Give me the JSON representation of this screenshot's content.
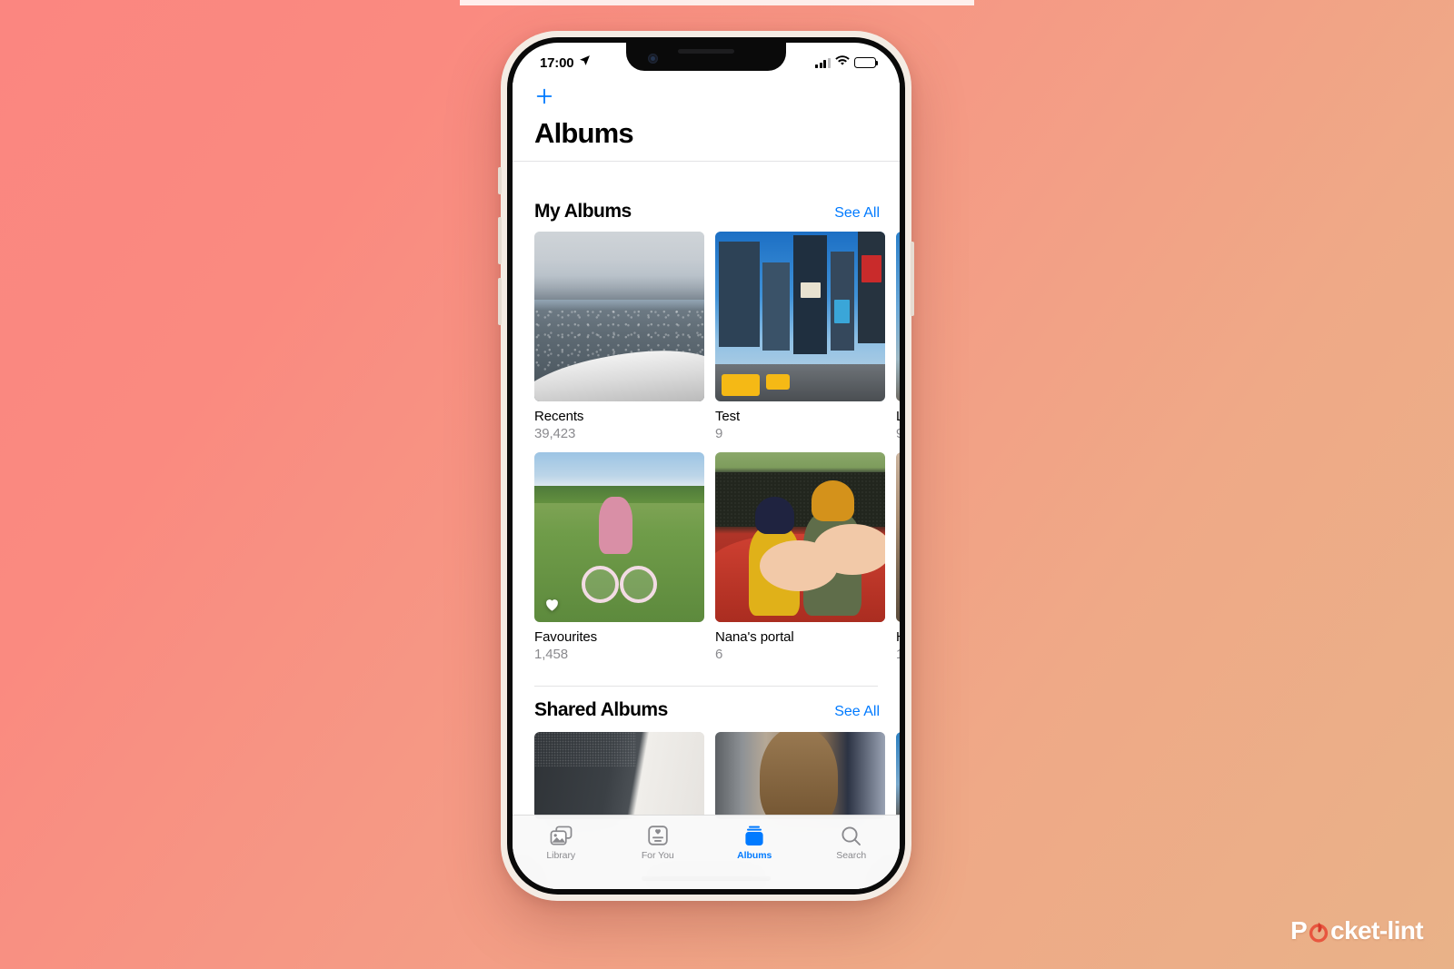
{
  "background": {
    "gradient_from": "#fb8680",
    "gradient_to": "#e9b288"
  },
  "status_bar": {
    "time": "17:00",
    "location_icon": "location-arrow-icon",
    "signal_icon": "cellular-signal-icon",
    "wifi_icon": "wifi-icon",
    "battery_icon": "battery-icon"
  },
  "nav": {
    "add_icon": "plus-icon",
    "title": "Albums"
  },
  "sections": [
    {
      "title": "My Albums",
      "see_all": "See All",
      "albums": [
        {
          "name": "Recents",
          "count": "39,423",
          "thumb": "aerial-view-from-plane",
          "badge": null
        },
        {
          "name": "Test",
          "count": "9",
          "thumb": "times-square-city",
          "badge": null
        },
        {
          "name": "L",
          "count": "9",
          "thumb": "city-street-partial",
          "badge": null
        },
        {
          "name": "Favourites",
          "count": "1,458",
          "thumb": "child-on-bicycle",
          "badge": "heart-icon"
        },
        {
          "name": "Nana's portal",
          "count": "6",
          "thumb": "kids-in-red-wagon",
          "badge": null
        },
        {
          "name": "H",
          "count": "1",
          "thumb": "partial-photo",
          "badge": null
        }
      ]
    },
    {
      "title": "Shared Albums",
      "see_all": "See All",
      "albums": [
        {
          "name": "",
          "count": "",
          "thumb": "dark-grey-room",
          "badge": null
        },
        {
          "name": "",
          "count": "",
          "thumb": "baby-on-airplane",
          "badge": null
        },
        {
          "name": "",
          "count": "",
          "thumb": "city-partial",
          "badge": null
        }
      ]
    }
  ],
  "tabbar": {
    "tabs": [
      {
        "label": "Library",
        "icon": "photos-library-icon",
        "active": false
      },
      {
        "label": "For You",
        "icon": "for-you-card-icon",
        "active": false
      },
      {
        "label": "Albums",
        "icon": "albums-stack-icon",
        "active": true
      },
      {
        "label": "Search",
        "icon": "search-magnifier-icon",
        "active": false
      }
    ],
    "active_color": "#007aff",
    "inactive_color": "#8a8a8e"
  },
  "watermark": {
    "text_before": "P",
    "text_after": "cket-lint",
    "logo_icon": "pocketlint-o-logo"
  }
}
